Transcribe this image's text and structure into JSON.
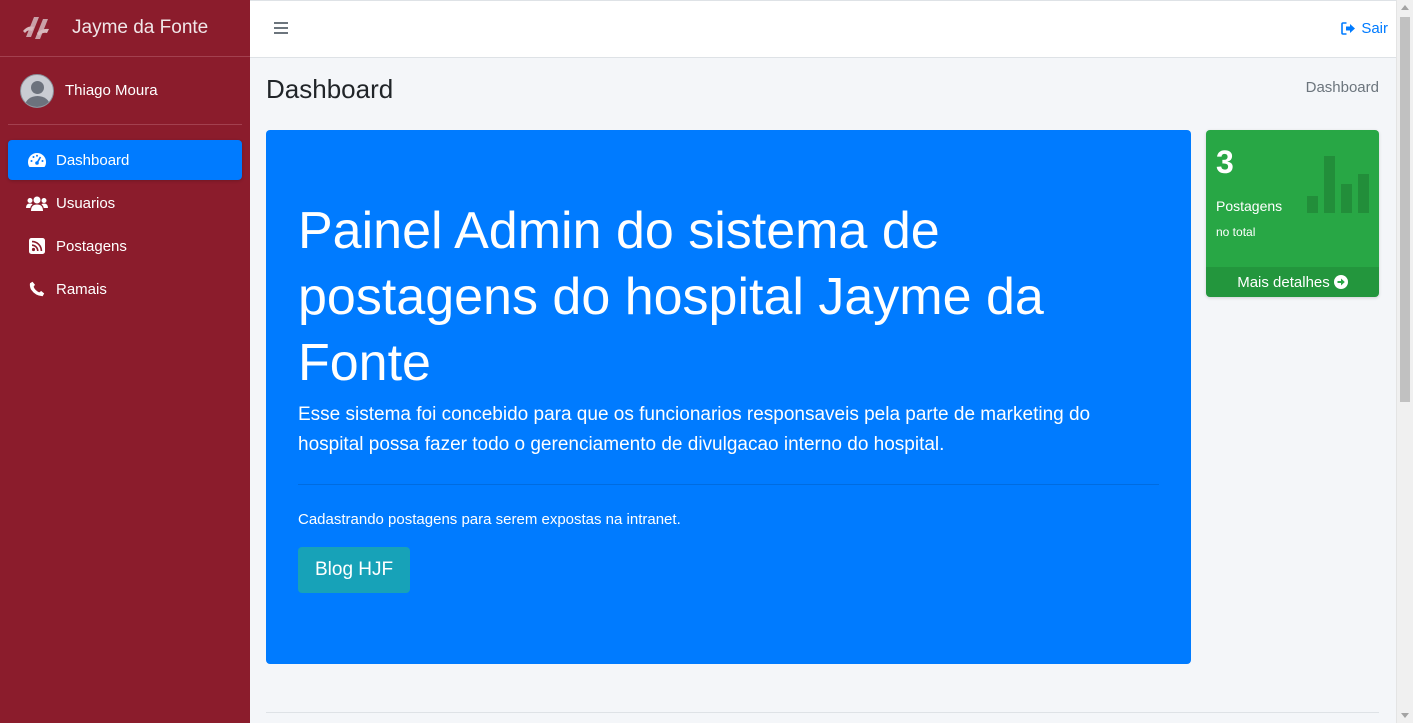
{
  "brand": {
    "name": "Jayme da Fonte",
    "icon": "jf-logo"
  },
  "user": {
    "name": "Thiago Moura"
  },
  "sidebar": {
    "items": [
      {
        "label": "Dashboard",
        "icon": "tachometer-icon",
        "active": true
      },
      {
        "label": "Usuarios",
        "icon": "users-icon"
      },
      {
        "label": "Postagens",
        "icon": "rss-icon"
      },
      {
        "label": "Ramais",
        "icon": "phone-icon"
      }
    ]
  },
  "navbar": {
    "logout_label": "Sair",
    "logout_icon": "sign-out-icon",
    "menu_icon": "bars-icon"
  },
  "header": {
    "title": "Dashboard",
    "breadcrumb": "Dashboard"
  },
  "jumbotron": {
    "title": "Painel Admin do sistema de postagens do hospital Jayme da Fonte",
    "lead": "Esse sistema foi concebido para que os funcionarios responsaveis pela parte de marketing do hospital possa fazer todo o gerenciamento de divulgacao interno do hospital.",
    "text": "Cadastrando postagens para serem expostas na intranet.",
    "button_label": "Blog HJF"
  },
  "stat_box": {
    "count": "3",
    "label": "Postagens",
    "sublabel": "no total",
    "footer_label": "Mais detalhes",
    "icon": "bar-chart-icon",
    "footer_icon": "arrow-circle-right-icon"
  },
  "colors": {
    "sidebar": "#8b1c2c",
    "primary": "#007bff",
    "success": "#28a745",
    "info": "#17a2b8"
  }
}
